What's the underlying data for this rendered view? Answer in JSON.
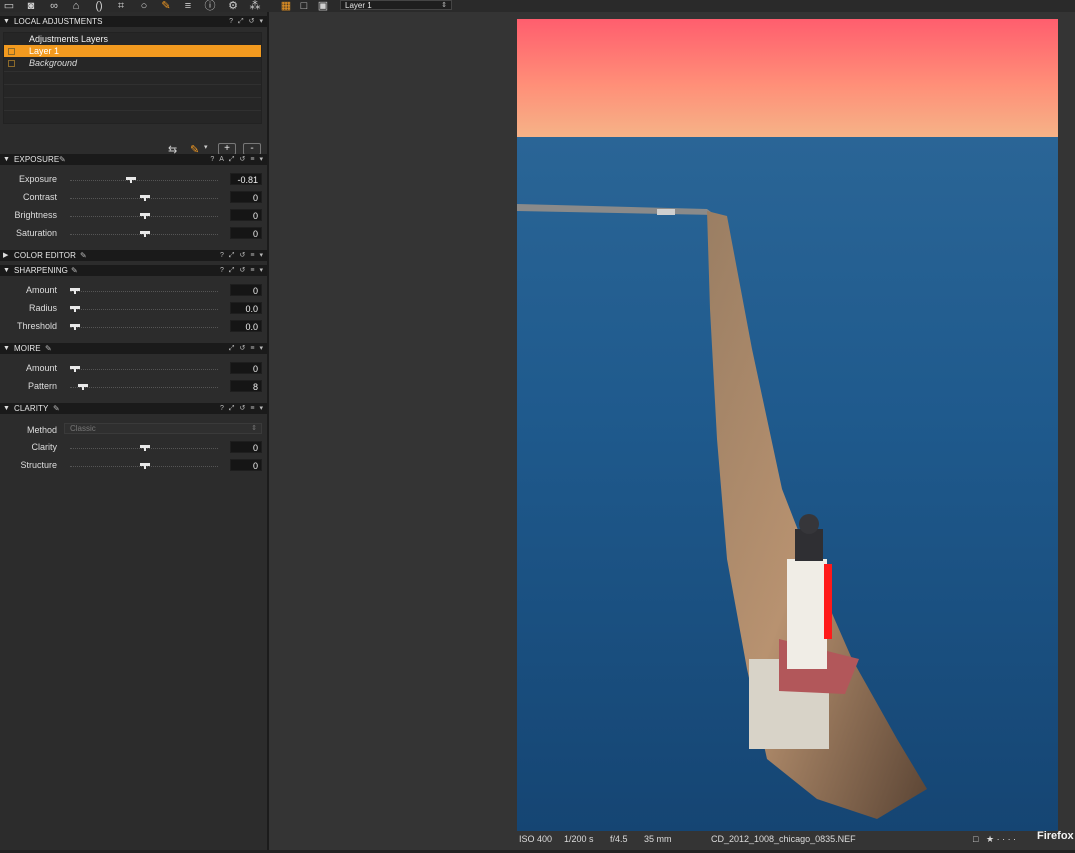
{
  "toolbar": {
    "tools": [
      "folder-icon",
      "camera-icon",
      "color-circles-icon",
      "shape-icon",
      "lens-icon",
      "crop-icon",
      "loupe-icon",
      "brush-icon",
      "list-icon",
      "info-icon",
      "gear-icon",
      "workflow-icon"
    ],
    "view_modes": [
      "grid-view-icon",
      "single-view-icon",
      "compare-view-icon"
    ],
    "layer_select": "Layer 1"
  },
  "local_adjustments": {
    "title": "LOCAL ADJUSTMENTS",
    "layers_header": "Adjustments Layers",
    "layers": [
      {
        "name": "Layer 1",
        "selected": true
      },
      {
        "name": "Background",
        "selected": false
      }
    ],
    "add_label": "+",
    "remove_label": "-"
  },
  "exposure": {
    "title": "EXPOSURE",
    "rows": [
      {
        "label": "Exposure",
        "value": "-0.81",
        "level": 0.4
      },
      {
        "label": "Contrast",
        "value": "0",
        "level": 0.5
      },
      {
        "label": "Brightness",
        "value": "0",
        "level": 0.5
      },
      {
        "label": "Saturation",
        "value": "0",
        "level": 0.5
      }
    ]
  },
  "color_editor": {
    "title": "COLOR EDITOR"
  },
  "sharpening": {
    "title": "SHARPENING",
    "rows": [
      {
        "label": "Amount",
        "value": "0",
        "level": 0.0
      },
      {
        "label": "Radius",
        "value": "0.0",
        "level": 0.0
      },
      {
        "label": "Threshold",
        "value": "0.0",
        "level": 0.0
      }
    ]
  },
  "moire": {
    "title": "MOIRE",
    "rows": [
      {
        "label": "Amount",
        "value": "0",
        "level": 0.0
      },
      {
        "label": "Pattern",
        "value": "8",
        "level": 0.06
      }
    ]
  },
  "clarity": {
    "title": "CLARITY",
    "method_label": "Method",
    "method_value": "Classic",
    "rows": [
      {
        "label": "Clarity",
        "value": "0",
        "level": 0.5
      },
      {
        "label": "Structure",
        "value": "0",
        "level": 0.5
      }
    ]
  },
  "status": {
    "iso": "ISO 400",
    "shutter": "1/200 s",
    "aperture": "f/4.5",
    "focal": "35 mm",
    "filename": "CD_2012_1008_chicago_0835.NEF",
    "rating": "★ · · · ·"
  },
  "firefox_label": "Firefox"
}
